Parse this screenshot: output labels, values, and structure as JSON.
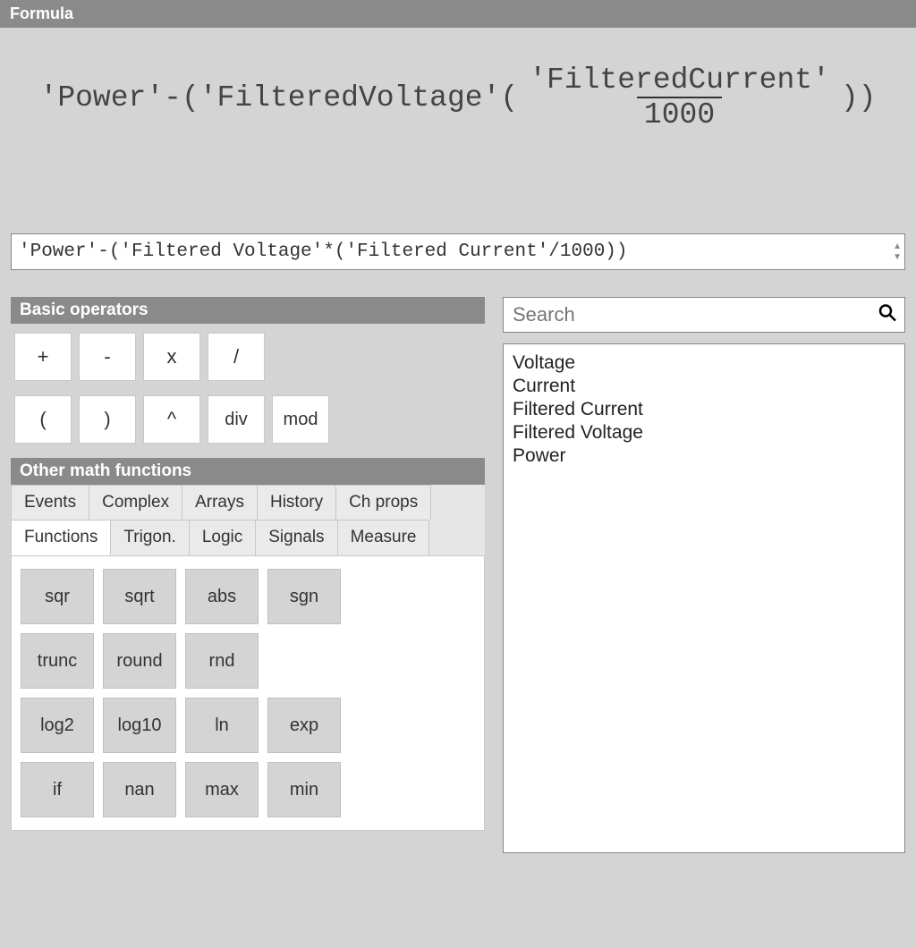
{
  "header": {
    "title": "Formula"
  },
  "formula": {
    "render_prefix": "'Power'-('FilteredVoltage'(",
    "render_num": "'FilteredCurrent'",
    "render_den": "1000",
    "render_suffix": "))",
    "input_value": "'Power'-('Filtered Voltage'*('Filtered Current'/1000))"
  },
  "operators": {
    "title": "Basic operators",
    "row1": {
      "add": "+",
      "sub": "-",
      "mul": "x",
      "div": "/"
    },
    "row2": {
      "lpar": "(",
      "rpar": ")",
      "pow": "^",
      "idiv": "div",
      "mod": "mod"
    }
  },
  "functions": {
    "title": "Other math functions",
    "tabs_row1": {
      "events": "Events",
      "complex": "Complex",
      "arrays": "Arrays",
      "history": "History",
      "chprops": "Ch props"
    },
    "tabs_row2": {
      "functions": "Functions",
      "trigon": "Trigon.",
      "logic": "Logic",
      "signals": "Signals",
      "measure": "Measure"
    },
    "items": {
      "sqr": "sqr",
      "sqrt": "sqrt",
      "abs": "abs",
      "sgn": "sgn",
      "trunc": "trunc",
      "round": "round",
      "rnd": "rnd",
      "log2": "log2",
      "log10": "log10",
      "ln": "ln",
      "exp": "exp",
      "if": "if",
      "nan": "nan",
      "max": "max",
      "min": "min"
    }
  },
  "search": {
    "placeholder": "Search"
  },
  "variables": {
    "voltage": "Voltage",
    "current": "Current",
    "filtered_current": "Filtered Current",
    "filtered_voltage": "Filtered Voltage",
    "power": "Power"
  }
}
